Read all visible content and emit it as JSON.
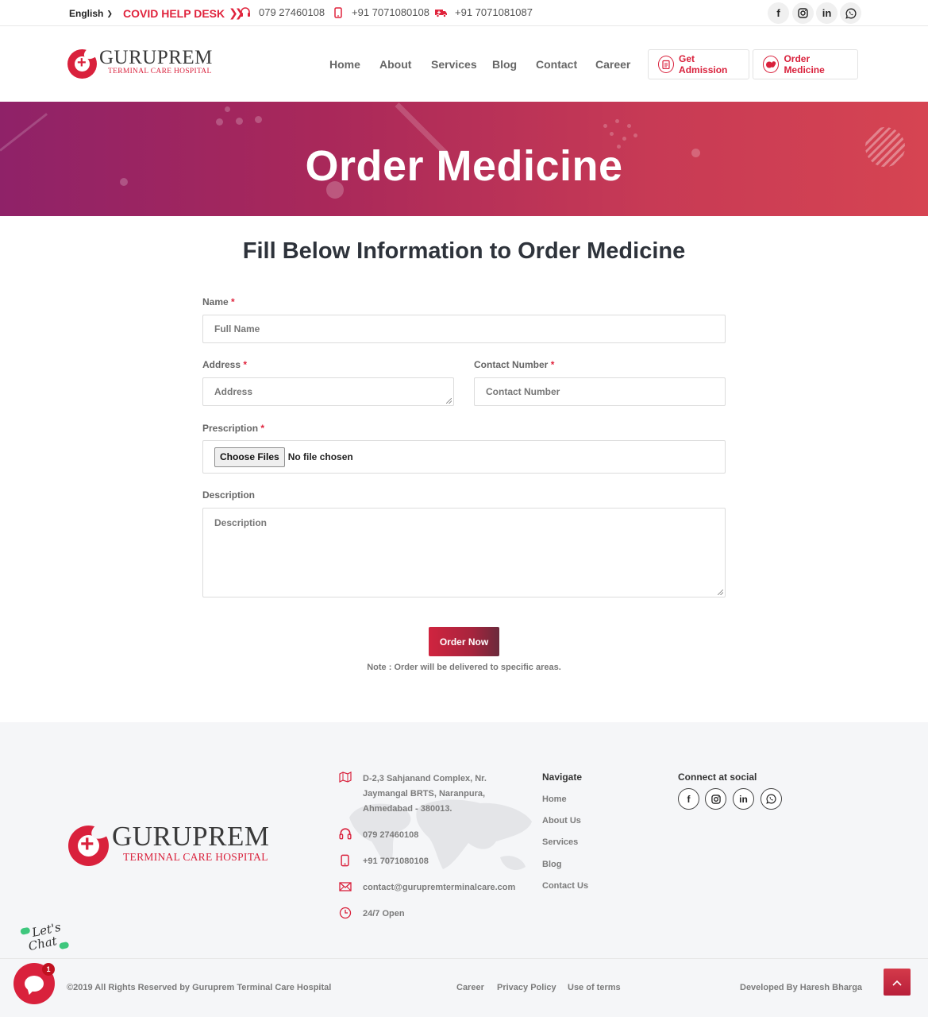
{
  "topbar": {
    "language": "English",
    "covid_label": "COVID HELP DESK",
    "phone1": "079 27460108",
    "phone2": "+91 7071080108",
    "ambulance": "+91 7071081087",
    "social": [
      "facebook",
      "instagram",
      "linkedin",
      "whatsapp"
    ]
  },
  "brand": {
    "name": "GURUPREM",
    "subtitle": "TERMINAL CARE HOSPITAL",
    "color": "#d9213c"
  },
  "nav": {
    "items": [
      "Home",
      "About",
      "Services",
      "Blog",
      "Contact",
      "Career"
    ],
    "admission_button": "Get Admission",
    "order_button": "Order Medicine"
  },
  "banner": {
    "title": "Order Medicine"
  },
  "form": {
    "heading": "Fill Below Information to Order Medicine",
    "name_label": "Name",
    "name_placeholder": "Full Name",
    "address_label": "Address",
    "address_placeholder": "Address",
    "contact_label": "Contact Number",
    "contact_placeholder": "Contact Number",
    "prescription_label": "Prescription",
    "file_button": "Choose Files",
    "file_status": "No file chosen",
    "description_label": "Description",
    "description_placeholder": "Description",
    "required_mark": "*",
    "submit": "Order Now",
    "note": "Note : Order will be delivered to specific areas."
  },
  "footer": {
    "address_lines": [
      "D-2,3 Sahjanand Complex, Nr.",
      "Jaymangal BRTS, Naranpura,",
      "Ahmedabad - 380013."
    ],
    "phone": "079 27460108",
    "mobile": "+91 7071080108",
    "email": "contact@gurupremterminalcare.com",
    "hours": "24/7 Open",
    "navigate_heading": "Navigate",
    "navigate_links": [
      "Home",
      "About Us",
      "Services",
      "Blog",
      "Contact Us"
    ],
    "social_heading": "Connect at social",
    "copyright": "©2019 All Rights Reserved by Guruprem Terminal Care Hospital",
    "bottom_links": [
      "Career",
      "Privacy Policy",
      "Use of terms"
    ],
    "developer": "Developed By Haresh Bharga"
  },
  "chat": {
    "badge": "1",
    "sticker_line1": "Let's",
    "sticker_line2": "Chat"
  }
}
